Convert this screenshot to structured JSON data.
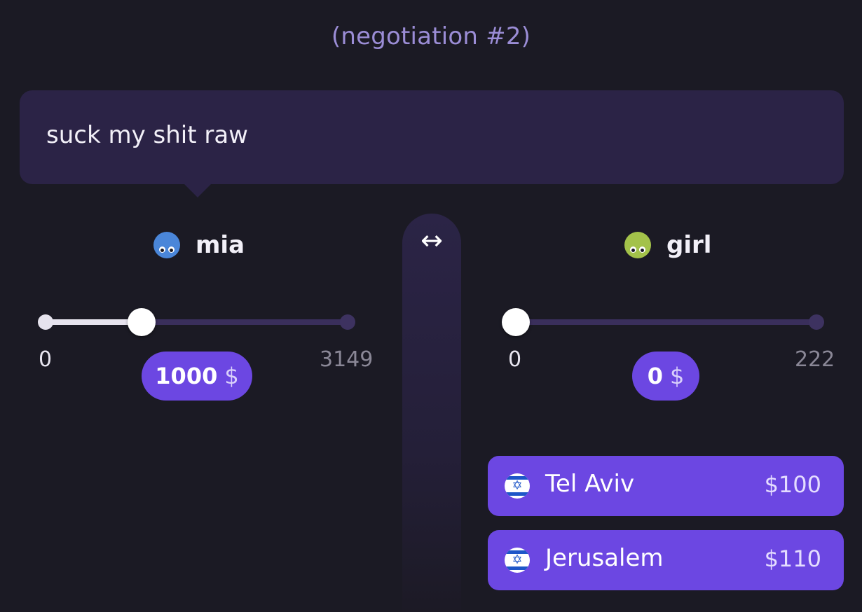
{
  "header": {
    "title": "(negotiation #2)"
  },
  "message": {
    "text": "suck my shit raw"
  },
  "swap": {
    "icon": "↔"
  },
  "left_party": {
    "name": "mia",
    "avatar_color": "#4a86d9",
    "slider": {
      "min": "0",
      "max": "3149",
      "value_number": 1000
    },
    "price": {
      "amount": "1000",
      "currency": "$"
    }
  },
  "right_party": {
    "name": "girl",
    "avatar_color": "#a3c24a",
    "slider": {
      "min": "0",
      "max": "222",
      "value_number": 0
    },
    "price": {
      "amount": "0",
      "currency": "$"
    }
  },
  "offers": [
    {
      "city": "Tel Aviv",
      "price": "$100",
      "flag": "israel-flag-icon"
    },
    {
      "city": "Jerusalem",
      "price": "$110",
      "flag": "israel-flag-icon"
    }
  ],
  "colors": {
    "accent": "#6c47e2",
    "background": "#1b1a24",
    "bubble": "#2b2346",
    "title": "#9b8dd6"
  }
}
